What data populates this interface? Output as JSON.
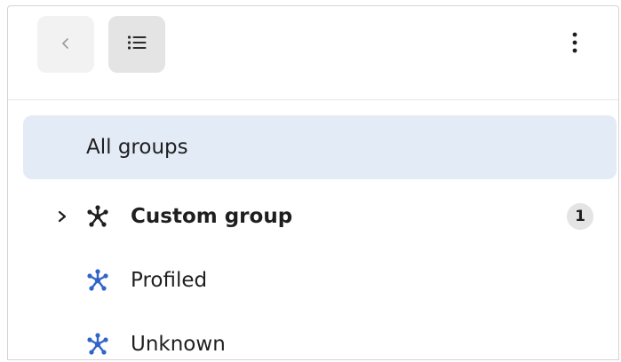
{
  "toolbar": {
    "back_icon": "chevron-left-icon",
    "list_icon": "list-icon",
    "more_icon": "more-vertical-icon"
  },
  "groups": {
    "all_groups_label": "All groups",
    "items": [
      {
        "label": "Custom group",
        "count": "1",
        "icon": "group-cluster-icon",
        "color": "#1f1f1f",
        "expandable": true
      },
      {
        "label": "Profiled",
        "icon": "group-cluster-icon",
        "color": "#2f64c9"
      },
      {
        "label": "Unknown",
        "icon": "group-cluster-icon",
        "color": "#2f64c9"
      }
    ]
  },
  "colors": {
    "selected_bg": "#e3ebf7",
    "accent": "#2f64c9"
  }
}
